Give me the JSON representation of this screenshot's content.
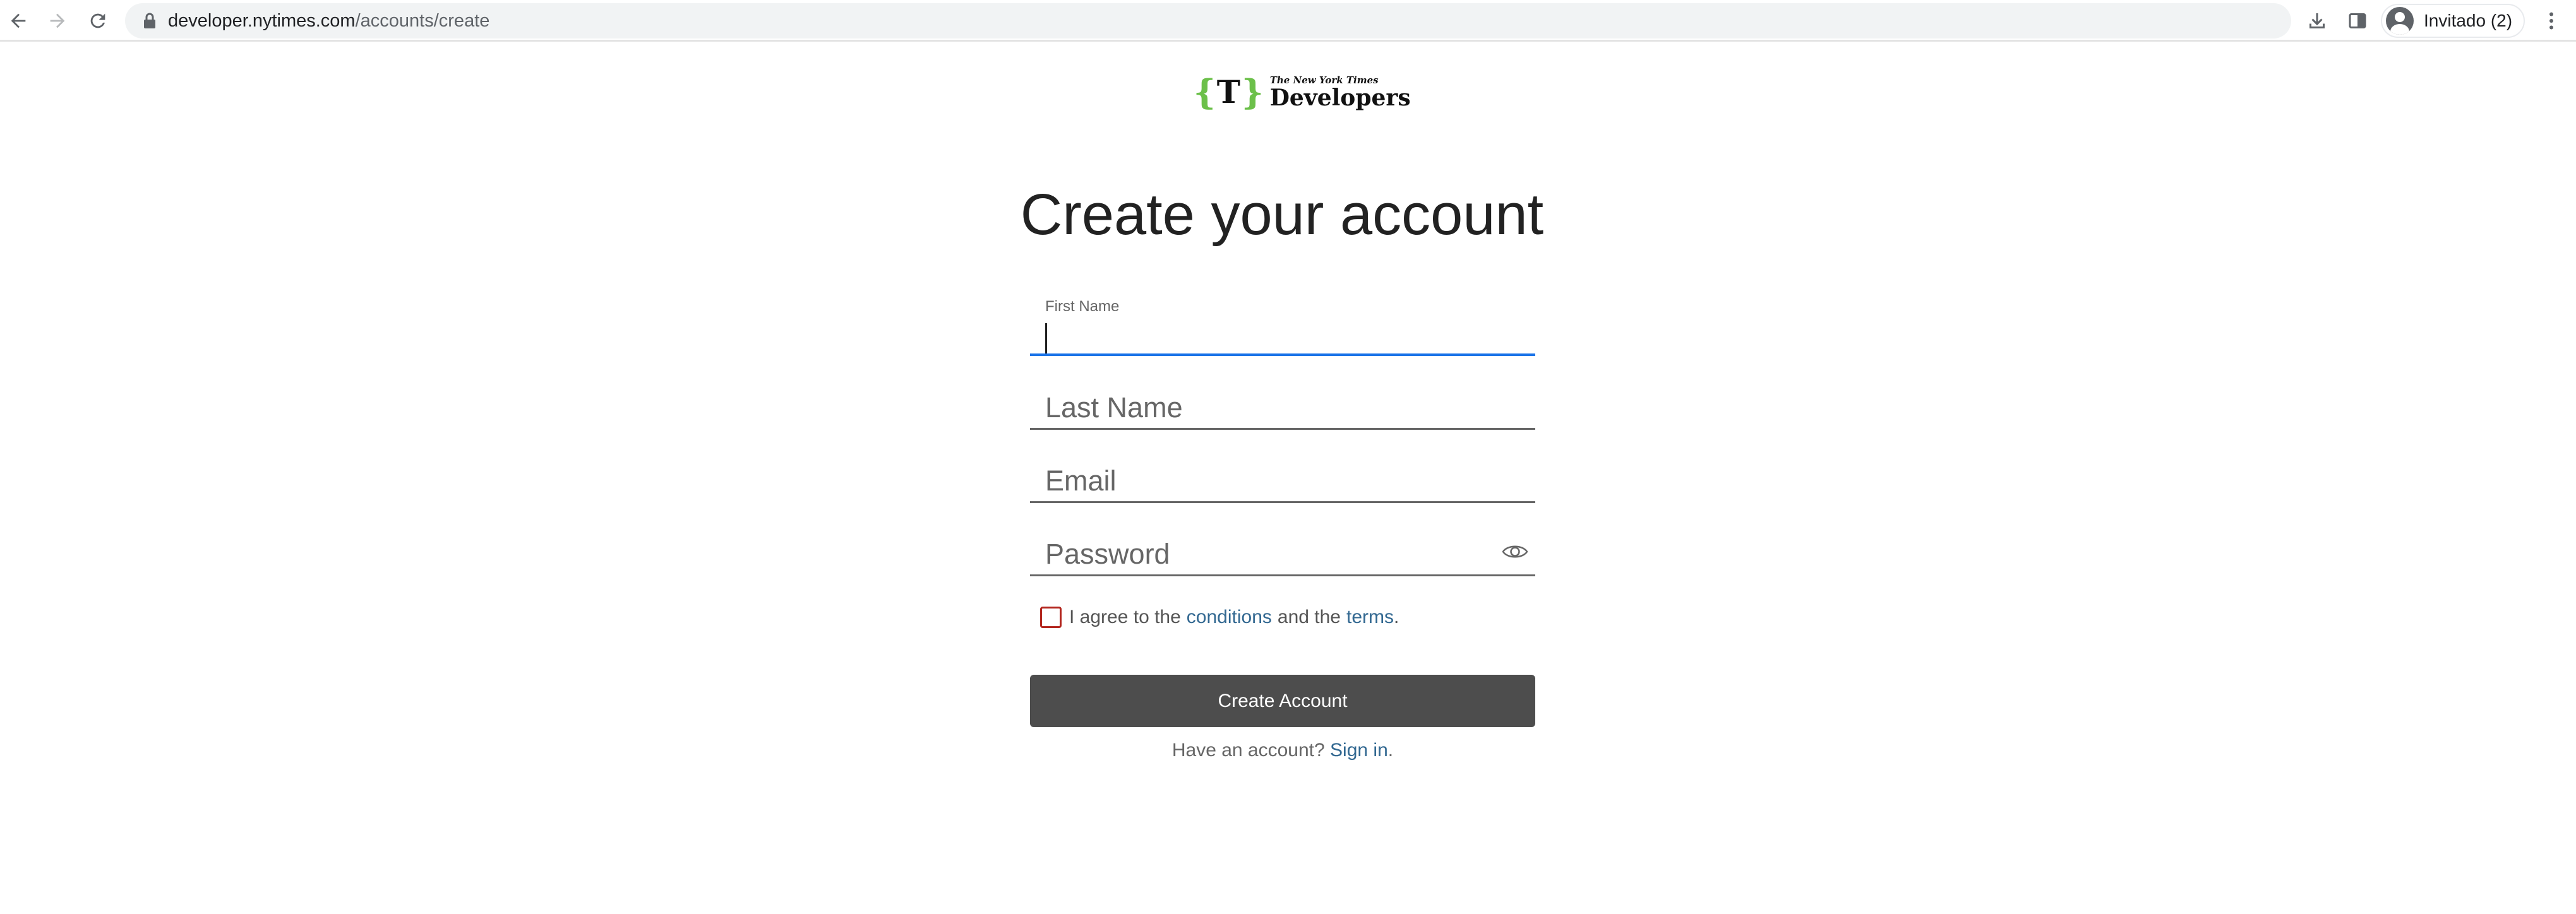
{
  "browser": {
    "url_host": "developer.nytimes.com",
    "url_path": "/accounts/create",
    "profile_label": "Invitado (2)"
  },
  "logo": {
    "bracket_open": "{",
    "mark": "T",
    "bracket_close": "}",
    "small_text": "The New York Times",
    "big_text": "Developers"
  },
  "page": {
    "title": "Create your account"
  },
  "form": {
    "first_name_label": "First Name",
    "first_name_value": "",
    "last_name_placeholder": "Last Name",
    "email_placeholder": "Email",
    "password_placeholder": "Password",
    "agree_prefix": "I agree to the",
    "conditions_link": "conditions",
    "agree_middle": "and the",
    "terms_link": "terms",
    "agree_suffix": ".",
    "agree_checked": false,
    "submit_label": "Create Account",
    "signin_prompt": "Have an account?",
    "signin_link": "Sign in",
    "signin_suffix": "."
  },
  "colors": {
    "link": "#326891",
    "button_bg": "#4d4d4d",
    "focus_underline": "#1a73e8",
    "checkbox_border": "#b3261e",
    "logo_accent": "#6cc04a"
  },
  "icons": {
    "back": "arrow-left-icon",
    "forward": "arrow-right-icon",
    "reload": "reload-icon",
    "lock": "lock-icon",
    "download": "download-icon",
    "side_panel": "side-panel-icon",
    "profile": "profile-avatar-icon",
    "menu": "kebab-menu-icon",
    "show_password": "eye-icon"
  }
}
